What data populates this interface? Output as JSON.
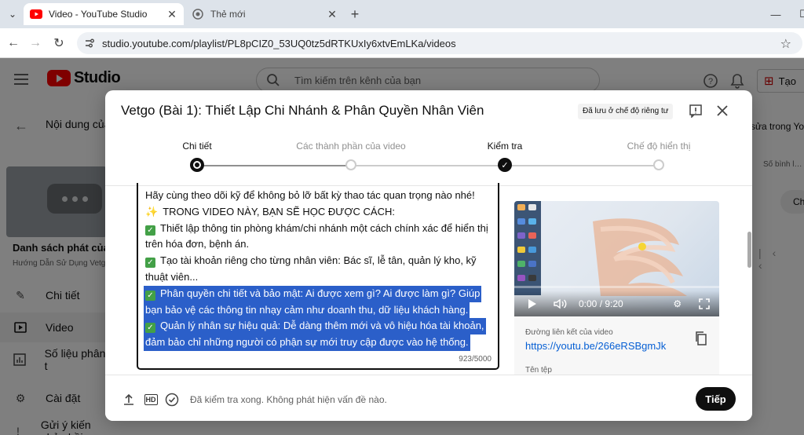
{
  "browser": {
    "tabs": [
      {
        "title": "Video - YouTube Studio",
        "active": true
      },
      {
        "title": "Thẻ mới",
        "active": false
      }
    ],
    "url": "studio.youtube.com/playlist/PL8pCIZ0_53UQ0tz5dRTKUxIy6xtvEmLKa/videos"
  },
  "studio": {
    "logo_text": "Studio",
    "search_placeholder": "Tìm kiếm trên kênh của bạn",
    "create_label": "Tạo",
    "page_title": "Nội dung của",
    "playlist_title": "Danh sách phát của",
    "playlist_sub": "Hướng Dẫn Sử Dụng Vetgo",
    "sidebar": [
      {
        "label": "Chi tiết",
        "icon": "pencil-icon"
      },
      {
        "label": "Video",
        "icon": "video-icon",
        "active": true
      },
      {
        "label": "Số liệu phân t",
        "icon": "analytics-icon"
      },
      {
        "label": "Cài đặt",
        "icon": "gear-icon"
      },
      {
        "label": "Gửi ý kiến phản hồi",
        "icon": "feedback-icon"
      }
    ],
    "right_peek": {
      "line1": "sửa trong Yo",
      "line2": "Số bình l…",
      "chip": "Ch"
    }
  },
  "modal": {
    "title": "Vetgo (Bài 1): Thiết Lập Chi Nhánh & Phân Quyền Nhân Viên",
    "saved_badge": "Đã lưu ở chế độ riêng tư",
    "steps": [
      {
        "label": "Chi tiết",
        "state": "current"
      },
      {
        "label": "Các thành phần của video",
        "state": "pending"
      },
      {
        "label": "Kiểm tra",
        "state": "done"
      },
      {
        "label": "Chế độ hiển thị",
        "state": "pending"
      }
    ],
    "description": {
      "lines": [
        {
          "text": "Hãy cùng theo dõi kỹ để không bỏ lỡ bất kỳ thao tác quan trọng nào nhé!",
          "prefix": "",
          "highlight": false
        },
        {
          "text": "TRONG VIDEO NÀY, BẠN SẼ HỌC ĐƯỢC CÁCH:",
          "prefix": "spark",
          "highlight": false
        },
        {
          "text": "Thiết lập thông tin phòng khám/chi nhánh một cách chính xác để hiển thị",
          "prefix": "check",
          "highlight": false
        },
        {
          "text": "trên hóa đơn, bệnh án.",
          "prefix": "",
          "highlight": false
        },
        {
          "text": "Tạo tài khoản riêng cho từng nhân viên: Bác sĩ, lễ tân, quản lý kho, kỹ",
          "prefix": "check",
          "highlight": false
        },
        {
          "text": "thuật viên...",
          "prefix": "",
          "highlight": false
        },
        {
          "text": "Phân quyền chi tiết và bảo mật: Ai được xem gì? Ai được làm gì? Giúp",
          "prefix": "check",
          "highlight": true
        },
        {
          "text": "bạn bảo vệ các thông tin nhạy cảm như doanh thu, dữ liệu khách hàng.",
          "prefix": "",
          "highlight": true
        },
        {
          "text": "Quản lý nhân sự hiệu quả: Dễ dàng thêm mới và vô hiệu hóa tài khoản,",
          "prefix": "check",
          "highlight": true
        },
        {
          "text": "đảm bảo chỉ những người có phận sự mới truy cập được vào hệ thống.",
          "prefix": "",
          "highlight": true
        }
      ],
      "counter": "923/5000"
    },
    "preview": {
      "time": "0:00 / 9:20",
      "progress": 0,
      "link_label": "Đường liên kết của video",
      "link_url": "https://youtu.be/266eRSBgmJk",
      "file_label": "Tên tệp"
    },
    "footer": {
      "status": "Đã kiểm tra xong. Không phát hiện vấn đề nào.",
      "next_label": "Tiếp"
    }
  },
  "colors": {
    "accent": "#065fd4",
    "selection": "#2b5fc9",
    "check": "#43a047",
    "brand": "#ff0000"
  }
}
